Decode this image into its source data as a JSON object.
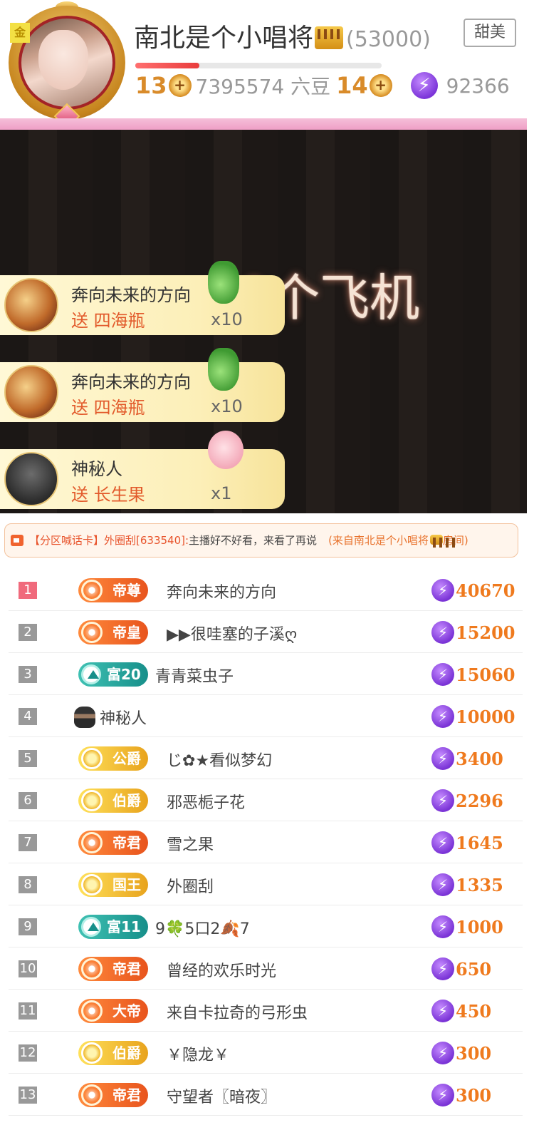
{
  "header": {
    "badge": "金",
    "anchor_name": "南北是个小唱将",
    "anchor_count": "(53000)",
    "tag": "甜美",
    "level_progress": 0.26,
    "level_current": "13",
    "beans": "7395574 六豆",
    "level_next": "14",
    "coins": "92366",
    "coin_icon": "⚡"
  },
  "video": {
    "caption": "10个飞机",
    "gifts": [
      {
        "user": "奔向未来的方向",
        "action": "送 四海瓶",
        "qty": "x10"
      },
      {
        "user": "奔向未来的方向",
        "action": "送 四海瓶",
        "qty": "x10"
      },
      {
        "user": "神秘人",
        "action": "送 长生果",
        "qty": "x1"
      }
    ]
  },
  "notice": {
    "tag": "【分区喊话卡】",
    "user": "外圈刮[633540]:",
    "text": "主播好不好看，来看了再说",
    "from": "(来自南北是个小唱将",
    "from_suffix": "房间)"
  },
  "leaderboard": [
    {
      "rank": "1",
      "badge": "帝尊",
      "style": "orange",
      "name": "奔向未来的方向",
      "value": "40670"
    },
    {
      "rank": "2",
      "badge": "帝皇",
      "style": "orange",
      "name": "▶▶很哇塞的子溪ღ",
      "value": "15200"
    },
    {
      "rank": "3",
      "badge": "富20",
      "style": "teal",
      "name": "青青菜虫子",
      "value": "15060"
    },
    {
      "rank": "4",
      "badge": "",
      "style": "mystery",
      "name": "神秘人",
      "value": "10000"
    },
    {
      "rank": "5",
      "badge": "公爵",
      "style": "gold",
      "name": "じ✿★看似梦幻",
      "value": "3400"
    },
    {
      "rank": "6",
      "badge": "伯爵",
      "style": "gold",
      "name": "邪恶栀子花",
      "value": "2296"
    },
    {
      "rank": "7",
      "badge": "帝君",
      "style": "orange",
      "name": "雪之果",
      "value": "1645"
    },
    {
      "rank": "8",
      "badge": "国王",
      "style": "gold",
      "name": "外圈刮",
      "value": "1335"
    },
    {
      "rank": "9",
      "badge": "富11",
      "style": "teal",
      "name": "9🍀5口2🍂7",
      "value": "1000"
    },
    {
      "rank": "10",
      "badge": "帝君",
      "style": "orange",
      "name": "曾经的欢乐时光",
      "value": "650"
    },
    {
      "rank": "11",
      "badge": "大帝",
      "style": "orange",
      "name": "来自卡拉奇的弓形虫",
      "value": "450"
    },
    {
      "rank": "12",
      "badge": "伯爵",
      "style": "gold",
      "name": "￥隐龙￥",
      "value": "300"
    },
    {
      "rank": "13",
      "badge": "帝君",
      "style": "orange",
      "name": "守望者〖暗夜〗",
      "value": "300"
    }
  ],
  "colors": {
    "accent": "#ef7a1e",
    "rank_top": "#f06a7c",
    "coin": "#7a33d6"
  }
}
